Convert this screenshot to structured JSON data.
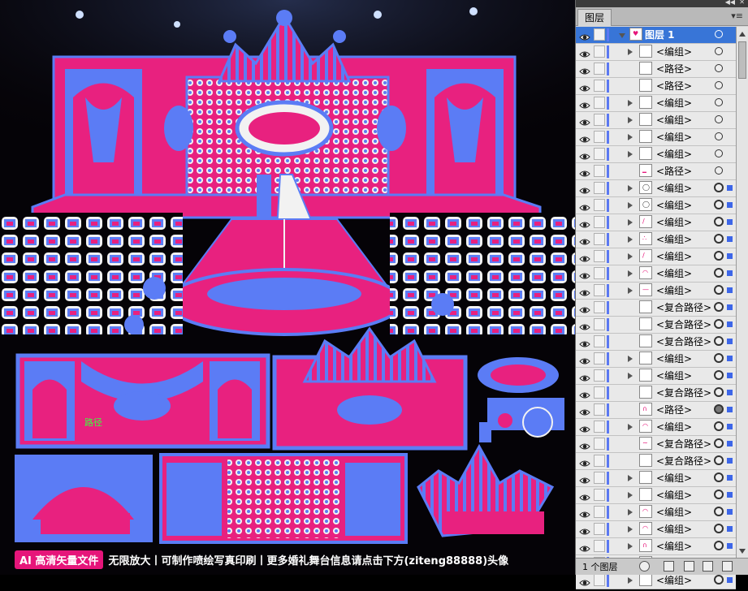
{
  "canvas": {
    "footer_badge": "AI 高清矢量文件",
    "footer_text": "无限放大丨可制作喷绘写真印刷丨更多婚礼舞台信息请点击下方(ziteng88888)头像",
    "inline_label": "路径",
    "colors": {
      "pink": "#e8217f",
      "blue": "#5b7cf5",
      "white": "#f2f2f2",
      "bg": "#050307"
    }
  },
  "panel": {
    "tab_label": "图层",
    "layer_count": "1 个图层",
    "rows": [
      {
        "label": "图层 1",
        "type": "layer",
        "expanded": true,
        "selected": true,
        "icon": "layer-thumb"
      },
      {
        "label": "<编组>",
        "type": "group",
        "icon": "blank"
      },
      {
        "label": "<路径>",
        "type": "path",
        "icon": "blank"
      },
      {
        "label": "<路径>",
        "type": "path",
        "icon": "blank"
      },
      {
        "label": "<编组>",
        "type": "group",
        "icon": "blank"
      },
      {
        "label": "<编组>",
        "type": "group",
        "icon": "blank"
      },
      {
        "label": "<编组>",
        "type": "group",
        "icon": "blank"
      },
      {
        "label": "<编组>",
        "type": "group",
        "icon": "blank"
      },
      {
        "label": "<路径>",
        "type": "path",
        "icon": "line"
      },
      {
        "label": "<编组>",
        "type": "group",
        "icon": "oval",
        "targeted": true
      },
      {
        "label": "<编组>",
        "type": "group",
        "icon": "oval",
        "targeted": true
      },
      {
        "label": "<编组>",
        "type": "group",
        "icon": "slash",
        "targeted": true
      },
      {
        "label": "<编组>",
        "type": "group",
        "icon": "dots",
        "targeted": true
      },
      {
        "label": "<编组>",
        "type": "group",
        "icon": "slash",
        "targeted": true
      },
      {
        "label": "<编组>",
        "type": "group",
        "icon": "lips",
        "targeted": true
      },
      {
        "label": "<编组>",
        "type": "group",
        "icon": "dash",
        "targeted": true
      },
      {
        "label": "<复合路径>",
        "type": "compound",
        "icon": "blank",
        "targeted": true
      },
      {
        "label": "<复合路径>",
        "type": "compound",
        "icon": "blank",
        "targeted": true
      },
      {
        "label": "<复合路径>",
        "type": "compound",
        "icon": "blank",
        "targeted": true
      },
      {
        "label": "<编组>",
        "type": "group",
        "icon": "blank",
        "targeted": true
      },
      {
        "label": "<编组>",
        "type": "group",
        "icon": "blank",
        "targeted": true
      },
      {
        "label": "<复合路径>",
        "type": "compound",
        "icon": "blank",
        "targeted": true
      },
      {
        "label": "<路径>",
        "type": "path",
        "icon": "arch",
        "targeted": true,
        "filled": true
      },
      {
        "label": "<编组>",
        "type": "group",
        "icon": "lips",
        "targeted": true
      },
      {
        "label": "<复合路径>",
        "type": "compound",
        "icon": "squiggle",
        "targeted": true
      },
      {
        "label": "<复合路径>",
        "type": "compound",
        "icon": "blank",
        "targeted": true
      },
      {
        "label": "<编组>",
        "type": "group",
        "icon": "blank",
        "targeted": true
      },
      {
        "label": "<编组>",
        "type": "group",
        "icon": "blank",
        "targeted": true
      },
      {
        "label": "<编组>",
        "type": "group",
        "icon": "lips",
        "targeted": true
      },
      {
        "label": "<编组>",
        "type": "group",
        "icon": "lips",
        "targeted": true
      },
      {
        "label": "<编组>",
        "type": "group",
        "icon": "arch",
        "targeted": true
      },
      {
        "label": "<复合路径>",
        "type": "compound",
        "icon": "blank",
        "targeted": true,
        "filled": true
      },
      {
        "label": "<编组>",
        "type": "group",
        "icon": "blank",
        "targeted": true
      }
    ]
  }
}
